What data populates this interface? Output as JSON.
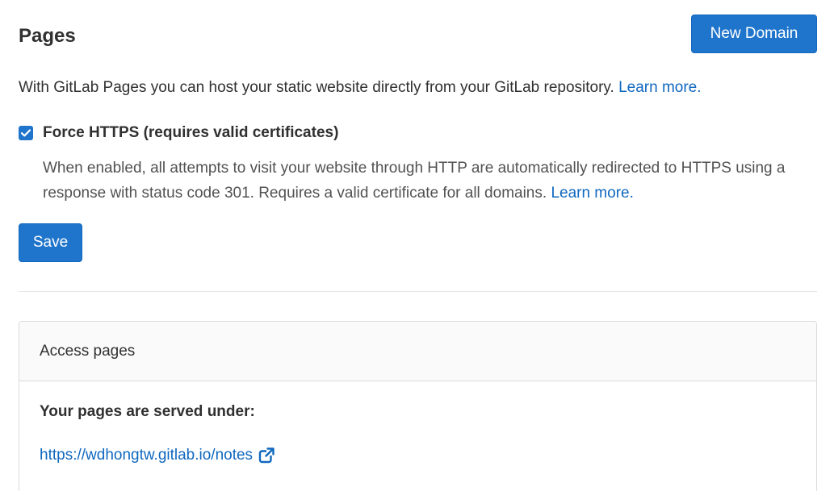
{
  "header": {
    "title": "Pages",
    "new_domain_label": "New Domain"
  },
  "intro": {
    "text": "With GitLab Pages you can host your static website directly from your GitLab repository. ",
    "learn_more": "Learn more."
  },
  "https": {
    "checked": true,
    "label": "Force HTTPS (requires valid certificates)",
    "help_text": "When enabled, all attempts to visit your website through HTTP are automatically redirected to HTTPS using a response with status code 301. Requires a valid certificate for all domains. ",
    "learn_more": "Learn more."
  },
  "save_label": "Save",
  "access_card": {
    "title": "Access pages",
    "served_label": "Your pages are served under:",
    "url": "https://wdhongtw.gitlab.io/notes",
    "url_icon": "external-link-icon"
  },
  "colors": {
    "primary": "#1f75cb",
    "link": "#1068bf"
  }
}
